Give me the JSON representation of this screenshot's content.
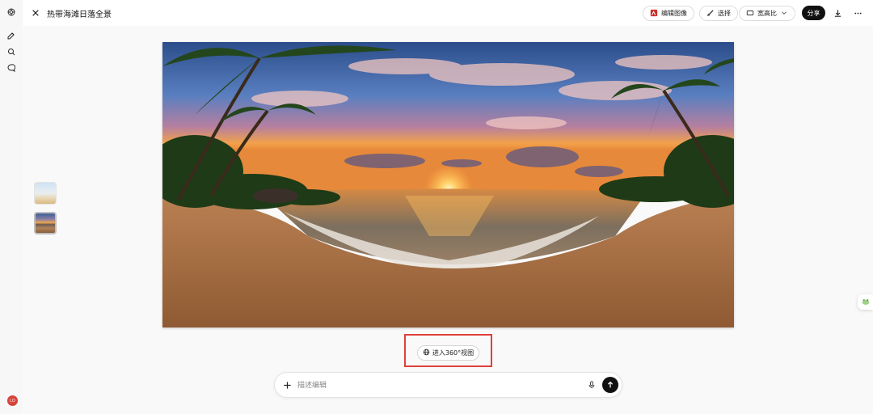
{
  "header": {
    "title": "热带海滩日落全景",
    "edit_image_label": "编辑图像",
    "select_label": "选择",
    "aspect_label": "宽高比",
    "share_label": "分享"
  },
  "sidebar": {
    "avatar_initials": "LO"
  },
  "canvas": {
    "view360_label": "进入360°视图"
  },
  "composer": {
    "placeholder": "描述编辑"
  },
  "colors": {
    "accent_red": "#e0403b",
    "dark": "#111111",
    "avatar_bg": "#d6433a"
  }
}
